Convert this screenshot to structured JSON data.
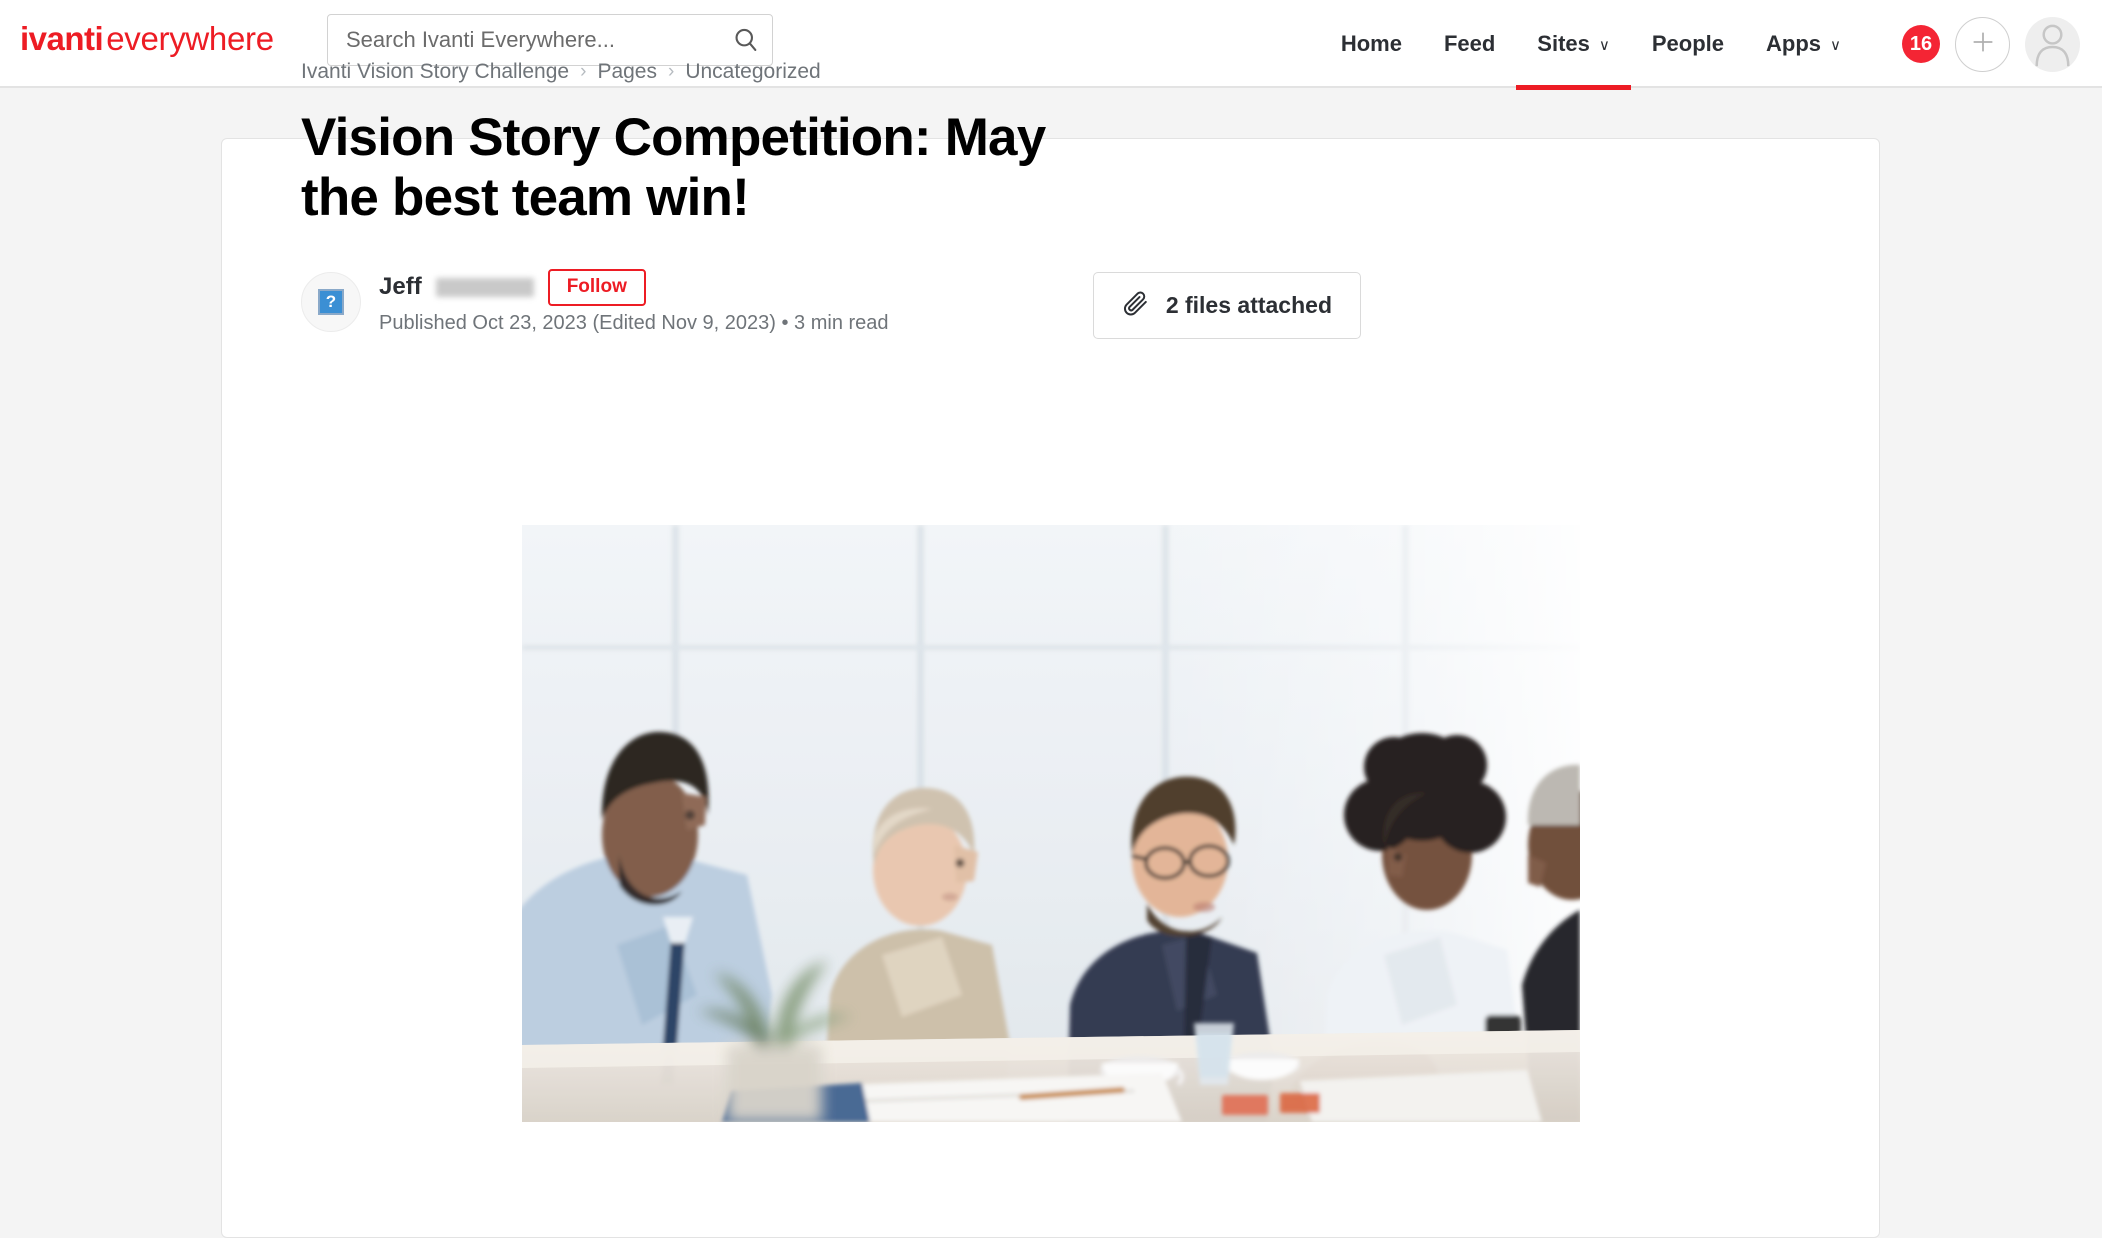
{
  "header": {
    "logo": {
      "brand": "ivanti",
      "suffix": "everywhere",
      "color": "#ed1c24"
    },
    "search": {
      "placeholder": "Search Ivanti Everywhere...",
      "value": "",
      "icon": "search-icon"
    },
    "nav": [
      {
        "label": "Home",
        "has_caret": false,
        "active": false
      },
      {
        "label": "Feed",
        "has_caret": false,
        "active": false
      },
      {
        "label": "Sites",
        "has_caret": true,
        "caret": "∨",
        "active": true
      },
      {
        "label": "People",
        "has_caret": false,
        "active": false
      },
      {
        "label": "Apps",
        "has_caret": true,
        "caret": "∨",
        "active": false
      }
    ],
    "notification_count": "16",
    "notification_color": "#f42534",
    "create_icon": "plus-icon",
    "profile_icon": "user-avatar-icon",
    "active_underline_color": "#ed1c24"
  },
  "article": {
    "breadcrumb": {
      "separator": "›",
      "items": [
        "Ivanti Vision Story Challenge",
        "Pages",
        "Uncategorized"
      ]
    },
    "title": "Vision Story Competition: May the best team win!",
    "author": {
      "first_name": "Jeff",
      "last_name_redacted": true,
      "avatar_icon": "broken-image-icon",
      "avatar_glyph": "?"
    },
    "follow_label": "Follow",
    "follow_color": "#ed1c24",
    "published_meta": "Published Oct 23, 2023 (Edited Nov 9, 2023) • 3 min read",
    "attachments": {
      "label": "2 files attached",
      "icon": "paperclip-icon"
    },
    "hero_image": {
      "alt": "Business team meeting around a table in a bright office",
      "icon": "hero-photo"
    }
  },
  "page": {
    "background": "#f4f4f4",
    "card_background": "#ffffff"
  }
}
